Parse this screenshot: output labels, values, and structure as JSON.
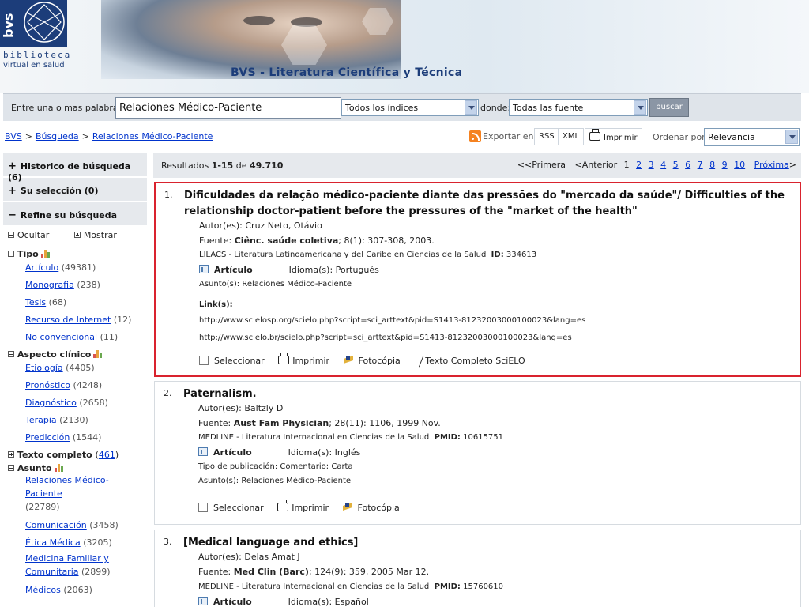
{
  "header": {
    "logo_letters": "bvs",
    "logo_line1": "biblioteca",
    "logo_line2": "virtual en salud",
    "site_title": "BVS - Literatura Científica y Técnica"
  },
  "search": {
    "label": "Entre una o mas palabras",
    "query": "Relaciones Médico-Paciente",
    "index_select": "Todos los índices",
    "where_label": "donde:",
    "source_select": "Todas las fuente",
    "submit_label": "buscar"
  },
  "breadcrumb": [
    "BVS",
    "Búsqueda",
    "Relaciones Médico-Paciente"
  ],
  "toolbar": {
    "export_label": "Exportar en",
    "rss": "RSS",
    "xml": "XML",
    "print": "Imprimir",
    "order_label": "Ordenar por",
    "order_value": "Relevancia"
  },
  "sidebar": {
    "history": {
      "label": "Historico de búsqueda",
      "count": "(6)"
    },
    "selection": {
      "label": "Su selección",
      "count": "(0)"
    },
    "refine": {
      "label": "Refine su búsqueda"
    },
    "hide": "Ocultar",
    "show": "Mostrar",
    "tipo": {
      "label": "Tipo",
      "items": [
        {
          "label": "Artículo",
          "count": "(49381)"
        },
        {
          "label": "Monografia",
          "count": "(238)"
        },
        {
          "label": "Tesis",
          "count": "(68)"
        },
        {
          "label": "Recurso de Internet",
          "count": "(12)"
        },
        {
          "label": "No convencional",
          "count": "(11)"
        }
      ]
    },
    "aspecto": {
      "label": "Aspecto clínico",
      "items": [
        {
          "label": "Etiología",
          "count": "(4405)"
        },
        {
          "label": "Pronóstico",
          "count": "(4248)"
        },
        {
          "label": "Diagnóstico",
          "count": "(2658)"
        },
        {
          "label": "Terapia",
          "count": "(2130)"
        },
        {
          "label": "Predicción",
          "count": "(1544)"
        }
      ]
    },
    "texto_completo": {
      "label": "Texto completo",
      "open": "(",
      "count": "461",
      "close": ")"
    },
    "asunto": {
      "label": "Asunto",
      "items": [
        {
          "label": "Relaciones Médico-Paciente",
          "count": "(22789)"
        },
        {
          "label": "Comunicación",
          "count": "(3458)"
        },
        {
          "label": "Ética Médica",
          "count": "(3205)"
        },
        {
          "label": "Medicina Familiar y Comunitaria",
          "count": "(2899)"
        },
        {
          "label": "Médicos",
          "count": "(2063)"
        }
      ]
    }
  },
  "results": {
    "label": "Resultados",
    "range": "1-15",
    "of": "de",
    "total": "49.710",
    "pager": {
      "first": "<<Primera",
      "prev": "<Anterior",
      "current": "1",
      "pages": [
        "2",
        "3",
        "4",
        "5",
        "6",
        "7",
        "8",
        "9",
        "10"
      ],
      "next": "Próxima",
      "next_arrow": ">"
    },
    "records": [
      {
        "num": "1.",
        "title": "Dificuldades da relação médico-paciente diante das pressões do \"mercado da saúde\"/ Difficulties of the relationship doctor-patient before the pressures of the \"market of the health\"",
        "authors_label": "Autor(es):",
        "authors": "Cruz Neto, Otávio",
        "source_label": "Fuente:",
        "source_journal": "Ciênc. saúde coletiva",
        "source_rest": "; 8(1): 307-308, 2003.",
        "database": "LILACS - Literatura Latinoamericana y del Caribe en Ciencias de la Salud",
        "id_label": "ID:",
        "id_value": "334613",
        "doc_type": "Artículo",
        "lang_label": "Idioma(s):",
        "lang": "Portugués",
        "subject_label": "Asunto(s):",
        "subject": "Relaciones Médico-Paciente",
        "links_label": "Link(s):",
        "links": [
          "http://www.scielosp.org/scielo.php?script=sci_arttext&pid=S1413-81232003000100023&lang=es",
          "http://www.scielo.br/scielo.php?script=sci_arttext&pid=S1413-81232003000100023&lang=es"
        ],
        "select": "Seleccionar",
        "print": "Imprimir",
        "photocopy": "Fotocópia",
        "fulltext": "Texto Completo SciELO"
      },
      {
        "num": "2.",
        "title": "Paternalism.",
        "authors_label": "Autor(es):",
        "authors": "Baltzly D",
        "source_label": "Fuente:",
        "source_journal": "Aust Fam Physician",
        "source_rest": "; 28(11): 1106, 1999 Nov.",
        "database": "MEDLINE - Literatura Internacional en Ciencias de la Salud",
        "id_label": "PMID:",
        "id_value": "10615751",
        "doc_type": "Artículo",
        "lang_label": "Idioma(s):",
        "lang": "Inglés",
        "pubtype": "Tipo de publicación: Comentario; Carta",
        "subject_label": "Asunto(s):",
        "subject": "Relaciones Médico-Paciente",
        "select": "Seleccionar",
        "print": "Imprimir",
        "photocopy": "Fotocópia"
      },
      {
        "num": "3.",
        "title": "[Medical language and ethics]",
        "authors_label": "Autor(es):",
        "authors": "Delas Amat J",
        "source_label": "Fuente:",
        "source_journal": "Med Clin (Barc)",
        "source_rest": "; 124(9): 359, 2005 Mar 12.",
        "database": "MEDLINE - Literatura Internacional en Ciencias de la Salud",
        "id_label": "PMID:",
        "id_value": "15760610",
        "doc_type": "Artículo",
        "lang_label": "Idioma(s):",
        "lang": "Español"
      }
    ]
  },
  "colors": {
    "brand_blue": "#1c3d7a",
    "link": "#0033cc",
    "selected_border": "#d9232e",
    "panel_gray": "#e6e9ed"
  }
}
